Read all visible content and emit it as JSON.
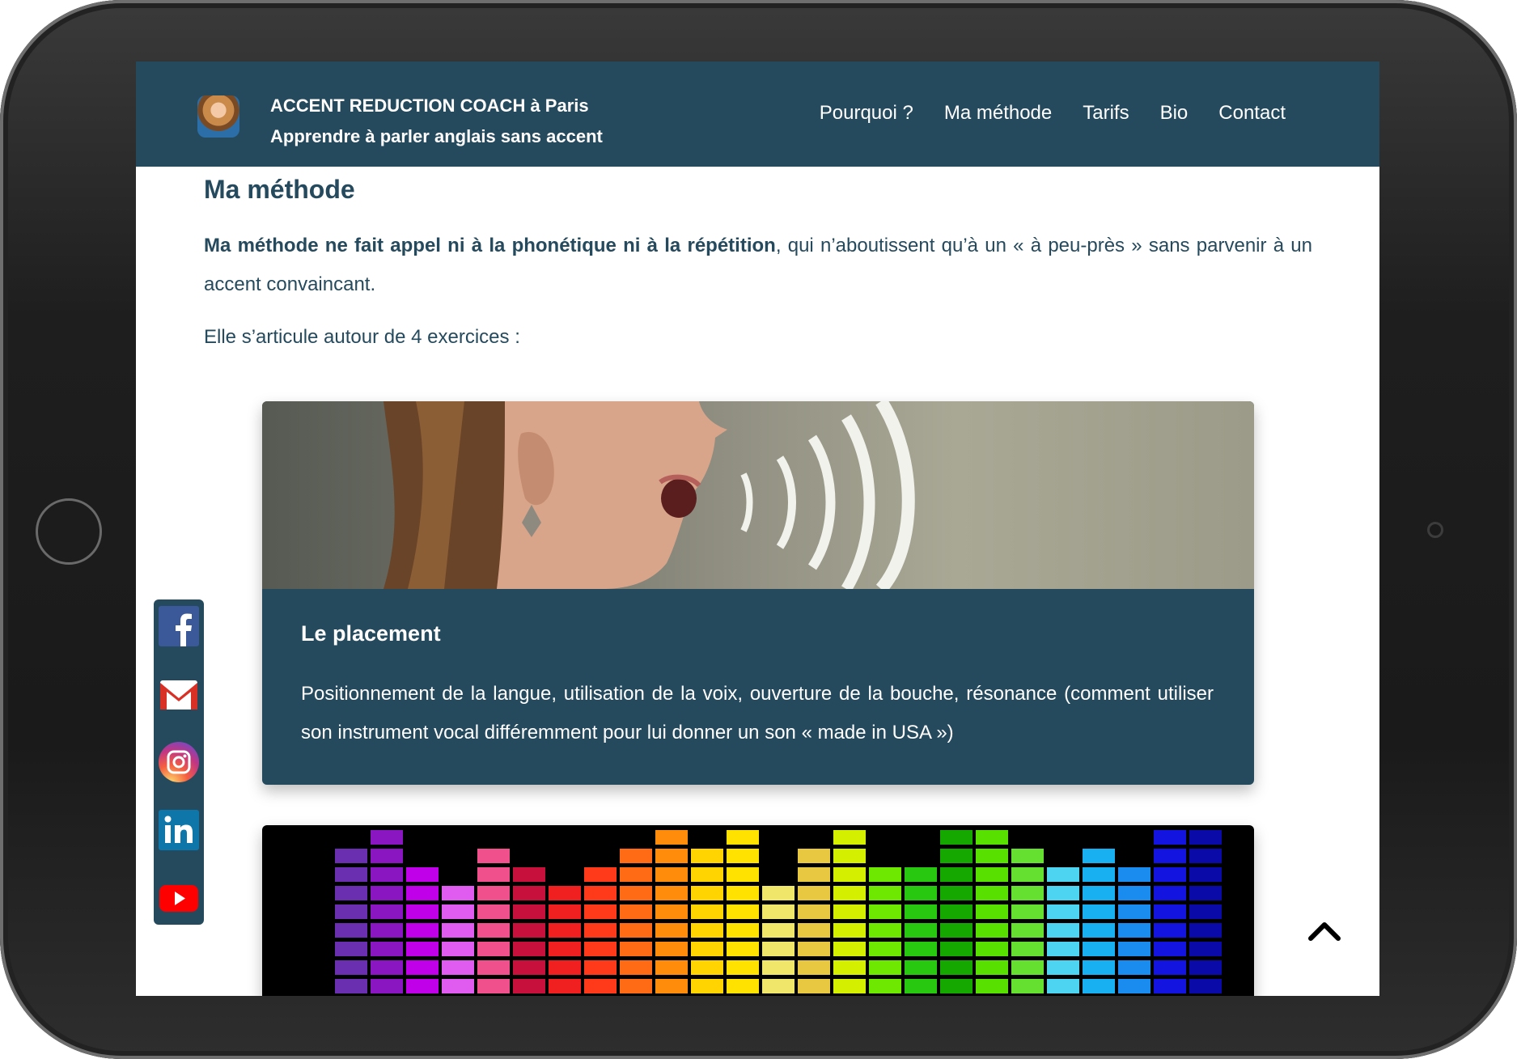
{
  "header": {
    "title_line1": "ACCENT REDUCTION COACH à Paris",
    "title_line2": "Apprendre à parler anglais sans accent",
    "nav": [
      "Pourquoi ?",
      "Ma méthode",
      "Tarifs",
      "Bio",
      "Contact"
    ]
  },
  "main": {
    "title": "Ma méthode",
    "intro_bold": "Ma méthode ne fait appel ni à la phonétique ni à la répétition",
    "intro_rest": ", qui n’aboutissent qu’à un « à peu-près » sans parvenir à un accent convaincant.",
    "intro_2": "Elle s’articule autour de 4 exercices :"
  },
  "cards": [
    {
      "title": "Le placement",
      "text": "Positionnement de la langue, utilisation de la voix, ouverture de la bouche, résonance (comment utiliser son instrument vocal différemment pour lui donner un son « made in USA »)"
    }
  ],
  "social": [
    "facebook-icon",
    "gmail-icon",
    "instagram-icon",
    "linkedin-icon",
    "youtube-icon"
  ],
  "colors": {
    "brand": "#254a5e",
    "text": "#254a5e",
    "on_brand": "#ffffff"
  }
}
